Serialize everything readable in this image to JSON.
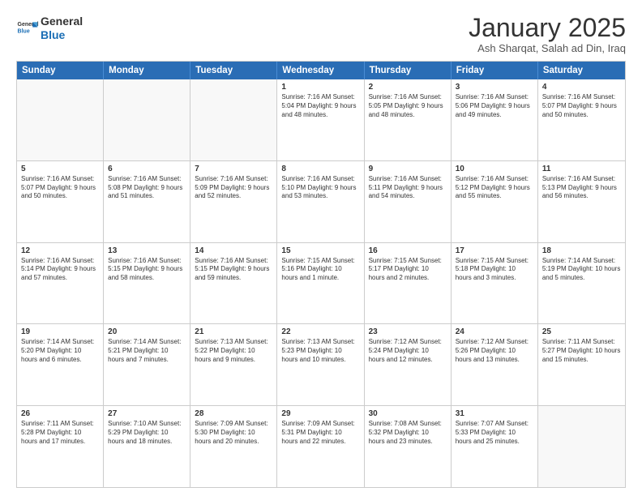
{
  "logo": {
    "line1": "General",
    "line2": "Blue"
  },
  "header": {
    "month": "January 2025",
    "location": "Ash Sharqat, Salah ad Din, Iraq"
  },
  "days": [
    "Sunday",
    "Monday",
    "Tuesday",
    "Wednesday",
    "Thursday",
    "Friday",
    "Saturday"
  ],
  "rows": [
    [
      {
        "day": "",
        "text": "",
        "empty": true
      },
      {
        "day": "",
        "text": "",
        "empty": true
      },
      {
        "day": "",
        "text": "",
        "empty": true
      },
      {
        "day": "1",
        "text": "Sunrise: 7:16 AM\nSunset: 5:04 PM\nDaylight: 9 hours and 48 minutes.",
        "empty": false
      },
      {
        "day": "2",
        "text": "Sunrise: 7:16 AM\nSunset: 5:05 PM\nDaylight: 9 hours and 48 minutes.",
        "empty": false
      },
      {
        "day": "3",
        "text": "Sunrise: 7:16 AM\nSunset: 5:06 PM\nDaylight: 9 hours and 49 minutes.",
        "empty": false
      },
      {
        "day": "4",
        "text": "Sunrise: 7:16 AM\nSunset: 5:07 PM\nDaylight: 9 hours and 50 minutes.",
        "empty": false
      }
    ],
    [
      {
        "day": "5",
        "text": "Sunrise: 7:16 AM\nSunset: 5:07 PM\nDaylight: 9 hours and 50 minutes.",
        "empty": false
      },
      {
        "day": "6",
        "text": "Sunrise: 7:16 AM\nSunset: 5:08 PM\nDaylight: 9 hours and 51 minutes.",
        "empty": false
      },
      {
        "day": "7",
        "text": "Sunrise: 7:16 AM\nSunset: 5:09 PM\nDaylight: 9 hours and 52 minutes.",
        "empty": false
      },
      {
        "day": "8",
        "text": "Sunrise: 7:16 AM\nSunset: 5:10 PM\nDaylight: 9 hours and 53 minutes.",
        "empty": false
      },
      {
        "day": "9",
        "text": "Sunrise: 7:16 AM\nSunset: 5:11 PM\nDaylight: 9 hours and 54 minutes.",
        "empty": false
      },
      {
        "day": "10",
        "text": "Sunrise: 7:16 AM\nSunset: 5:12 PM\nDaylight: 9 hours and 55 minutes.",
        "empty": false
      },
      {
        "day": "11",
        "text": "Sunrise: 7:16 AM\nSunset: 5:13 PM\nDaylight: 9 hours and 56 minutes.",
        "empty": false
      }
    ],
    [
      {
        "day": "12",
        "text": "Sunrise: 7:16 AM\nSunset: 5:14 PM\nDaylight: 9 hours and 57 minutes.",
        "empty": false
      },
      {
        "day": "13",
        "text": "Sunrise: 7:16 AM\nSunset: 5:15 PM\nDaylight: 9 hours and 58 minutes.",
        "empty": false
      },
      {
        "day": "14",
        "text": "Sunrise: 7:16 AM\nSunset: 5:15 PM\nDaylight: 9 hours and 59 minutes.",
        "empty": false
      },
      {
        "day": "15",
        "text": "Sunrise: 7:15 AM\nSunset: 5:16 PM\nDaylight: 10 hours and 1 minute.",
        "empty": false
      },
      {
        "day": "16",
        "text": "Sunrise: 7:15 AM\nSunset: 5:17 PM\nDaylight: 10 hours and 2 minutes.",
        "empty": false
      },
      {
        "day": "17",
        "text": "Sunrise: 7:15 AM\nSunset: 5:18 PM\nDaylight: 10 hours and 3 minutes.",
        "empty": false
      },
      {
        "day": "18",
        "text": "Sunrise: 7:14 AM\nSunset: 5:19 PM\nDaylight: 10 hours and 5 minutes.",
        "empty": false
      }
    ],
    [
      {
        "day": "19",
        "text": "Sunrise: 7:14 AM\nSunset: 5:20 PM\nDaylight: 10 hours and 6 minutes.",
        "empty": false
      },
      {
        "day": "20",
        "text": "Sunrise: 7:14 AM\nSunset: 5:21 PM\nDaylight: 10 hours and 7 minutes.",
        "empty": false
      },
      {
        "day": "21",
        "text": "Sunrise: 7:13 AM\nSunset: 5:22 PM\nDaylight: 10 hours and 9 minutes.",
        "empty": false
      },
      {
        "day": "22",
        "text": "Sunrise: 7:13 AM\nSunset: 5:23 PM\nDaylight: 10 hours and 10 minutes.",
        "empty": false
      },
      {
        "day": "23",
        "text": "Sunrise: 7:12 AM\nSunset: 5:24 PM\nDaylight: 10 hours and 12 minutes.",
        "empty": false
      },
      {
        "day": "24",
        "text": "Sunrise: 7:12 AM\nSunset: 5:26 PM\nDaylight: 10 hours and 13 minutes.",
        "empty": false
      },
      {
        "day": "25",
        "text": "Sunrise: 7:11 AM\nSunset: 5:27 PM\nDaylight: 10 hours and 15 minutes.",
        "empty": false
      }
    ],
    [
      {
        "day": "26",
        "text": "Sunrise: 7:11 AM\nSunset: 5:28 PM\nDaylight: 10 hours and 17 minutes.",
        "empty": false
      },
      {
        "day": "27",
        "text": "Sunrise: 7:10 AM\nSunset: 5:29 PM\nDaylight: 10 hours and 18 minutes.",
        "empty": false
      },
      {
        "day": "28",
        "text": "Sunrise: 7:09 AM\nSunset: 5:30 PM\nDaylight: 10 hours and 20 minutes.",
        "empty": false
      },
      {
        "day": "29",
        "text": "Sunrise: 7:09 AM\nSunset: 5:31 PM\nDaylight: 10 hours and 22 minutes.",
        "empty": false
      },
      {
        "day": "30",
        "text": "Sunrise: 7:08 AM\nSunset: 5:32 PM\nDaylight: 10 hours and 23 minutes.",
        "empty": false
      },
      {
        "day": "31",
        "text": "Sunrise: 7:07 AM\nSunset: 5:33 PM\nDaylight: 10 hours and 25 minutes.",
        "empty": false
      },
      {
        "day": "",
        "text": "",
        "empty": true
      }
    ]
  ]
}
